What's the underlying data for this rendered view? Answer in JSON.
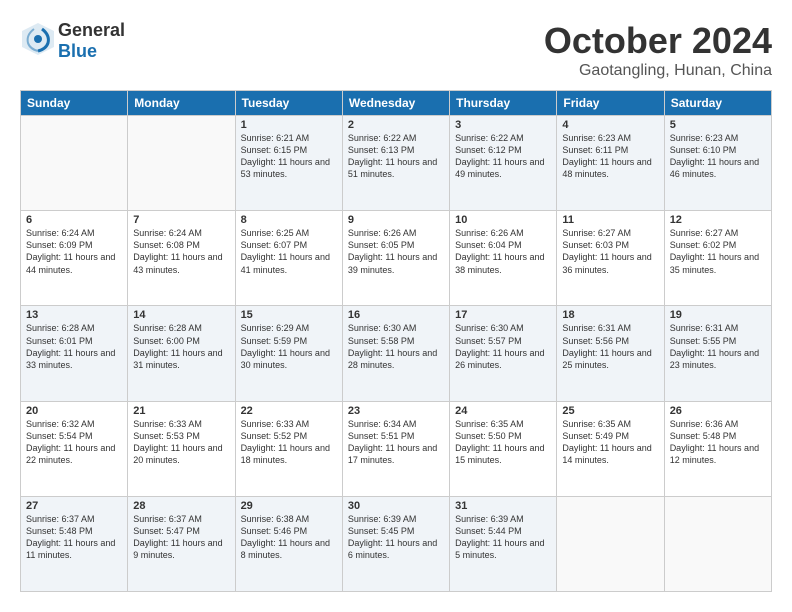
{
  "header": {
    "logo_line1": "General",
    "logo_line2": "Blue",
    "month": "October 2024",
    "location": "Gaotangling, Hunan, China"
  },
  "weekdays": [
    "Sunday",
    "Monday",
    "Tuesday",
    "Wednesday",
    "Thursday",
    "Friday",
    "Saturday"
  ],
  "weeks": [
    [
      {
        "day": "",
        "sunrise": "",
        "sunset": "",
        "daylight": ""
      },
      {
        "day": "",
        "sunrise": "",
        "sunset": "",
        "daylight": ""
      },
      {
        "day": "1",
        "sunrise": "Sunrise: 6:21 AM",
        "sunset": "Sunset: 6:15 PM",
        "daylight": "Daylight: 11 hours and 53 minutes."
      },
      {
        "day": "2",
        "sunrise": "Sunrise: 6:22 AM",
        "sunset": "Sunset: 6:13 PM",
        "daylight": "Daylight: 11 hours and 51 minutes."
      },
      {
        "day": "3",
        "sunrise": "Sunrise: 6:22 AM",
        "sunset": "Sunset: 6:12 PM",
        "daylight": "Daylight: 11 hours and 49 minutes."
      },
      {
        "day": "4",
        "sunrise": "Sunrise: 6:23 AM",
        "sunset": "Sunset: 6:11 PM",
        "daylight": "Daylight: 11 hours and 48 minutes."
      },
      {
        "day": "5",
        "sunrise": "Sunrise: 6:23 AM",
        "sunset": "Sunset: 6:10 PM",
        "daylight": "Daylight: 11 hours and 46 minutes."
      }
    ],
    [
      {
        "day": "6",
        "sunrise": "Sunrise: 6:24 AM",
        "sunset": "Sunset: 6:09 PM",
        "daylight": "Daylight: 11 hours and 44 minutes."
      },
      {
        "day": "7",
        "sunrise": "Sunrise: 6:24 AM",
        "sunset": "Sunset: 6:08 PM",
        "daylight": "Daylight: 11 hours and 43 minutes."
      },
      {
        "day": "8",
        "sunrise": "Sunrise: 6:25 AM",
        "sunset": "Sunset: 6:07 PM",
        "daylight": "Daylight: 11 hours and 41 minutes."
      },
      {
        "day": "9",
        "sunrise": "Sunrise: 6:26 AM",
        "sunset": "Sunset: 6:05 PM",
        "daylight": "Daylight: 11 hours and 39 minutes."
      },
      {
        "day": "10",
        "sunrise": "Sunrise: 6:26 AM",
        "sunset": "Sunset: 6:04 PM",
        "daylight": "Daylight: 11 hours and 38 minutes."
      },
      {
        "day": "11",
        "sunrise": "Sunrise: 6:27 AM",
        "sunset": "Sunset: 6:03 PM",
        "daylight": "Daylight: 11 hours and 36 minutes."
      },
      {
        "day": "12",
        "sunrise": "Sunrise: 6:27 AM",
        "sunset": "Sunset: 6:02 PM",
        "daylight": "Daylight: 11 hours and 35 minutes."
      }
    ],
    [
      {
        "day": "13",
        "sunrise": "Sunrise: 6:28 AM",
        "sunset": "Sunset: 6:01 PM",
        "daylight": "Daylight: 11 hours and 33 minutes."
      },
      {
        "day": "14",
        "sunrise": "Sunrise: 6:28 AM",
        "sunset": "Sunset: 6:00 PM",
        "daylight": "Daylight: 11 hours and 31 minutes."
      },
      {
        "day": "15",
        "sunrise": "Sunrise: 6:29 AM",
        "sunset": "Sunset: 5:59 PM",
        "daylight": "Daylight: 11 hours and 30 minutes."
      },
      {
        "day": "16",
        "sunrise": "Sunrise: 6:30 AM",
        "sunset": "Sunset: 5:58 PM",
        "daylight": "Daylight: 11 hours and 28 minutes."
      },
      {
        "day": "17",
        "sunrise": "Sunrise: 6:30 AM",
        "sunset": "Sunset: 5:57 PM",
        "daylight": "Daylight: 11 hours and 26 minutes."
      },
      {
        "day": "18",
        "sunrise": "Sunrise: 6:31 AM",
        "sunset": "Sunset: 5:56 PM",
        "daylight": "Daylight: 11 hours and 25 minutes."
      },
      {
        "day": "19",
        "sunrise": "Sunrise: 6:31 AM",
        "sunset": "Sunset: 5:55 PM",
        "daylight": "Daylight: 11 hours and 23 minutes."
      }
    ],
    [
      {
        "day": "20",
        "sunrise": "Sunrise: 6:32 AM",
        "sunset": "Sunset: 5:54 PM",
        "daylight": "Daylight: 11 hours and 22 minutes."
      },
      {
        "day": "21",
        "sunrise": "Sunrise: 6:33 AM",
        "sunset": "Sunset: 5:53 PM",
        "daylight": "Daylight: 11 hours and 20 minutes."
      },
      {
        "day": "22",
        "sunrise": "Sunrise: 6:33 AM",
        "sunset": "Sunset: 5:52 PM",
        "daylight": "Daylight: 11 hours and 18 minutes."
      },
      {
        "day": "23",
        "sunrise": "Sunrise: 6:34 AM",
        "sunset": "Sunset: 5:51 PM",
        "daylight": "Daylight: 11 hours and 17 minutes."
      },
      {
        "day": "24",
        "sunrise": "Sunrise: 6:35 AM",
        "sunset": "Sunset: 5:50 PM",
        "daylight": "Daylight: 11 hours and 15 minutes."
      },
      {
        "day": "25",
        "sunrise": "Sunrise: 6:35 AM",
        "sunset": "Sunset: 5:49 PM",
        "daylight": "Daylight: 11 hours and 14 minutes."
      },
      {
        "day": "26",
        "sunrise": "Sunrise: 6:36 AM",
        "sunset": "Sunset: 5:48 PM",
        "daylight": "Daylight: 11 hours and 12 minutes."
      }
    ],
    [
      {
        "day": "27",
        "sunrise": "Sunrise: 6:37 AM",
        "sunset": "Sunset: 5:48 PM",
        "daylight": "Daylight: 11 hours and 11 minutes."
      },
      {
        "day": "28",
        "sunrise": "Sunrise: 6:37 AM",
        "sunset": "Sunset: 5:47 PM",
        "daylight": "Daylight: 11 hours and 9 minutes."
      },
      {
        "day": "29",
        "sunrise": "Sunrise: 6:38 AM",
        "sunset": "Sunset: 5:46 PM",
        "daylight": "Daylight: 11 hours and 8 minutes."
      },
      {
        "day": "30",
        "sunrise": "Sunrise: 6:39 AM",
        "sunset": "Sunset: 5:45 PM",
        "daylight": "Daylight: 11 hours and 6 minutes."
      },
      {
        "day": "31",
        "sunrise": "Sunrise: 6:39 AM",
        "sunset": "Sunset: 5:44 PM",
        "daylight": "Daylight: 11 hours and 5 minutes."
      },
      {
        "day": "",
        "sunrise": "",
        "sunset": "",
        "daylight": ""
      },
      {
        "day": "",
        "sunrise": "",
        "sunset": "",
        "daylight": ""
      }
    ]
  ]
}
